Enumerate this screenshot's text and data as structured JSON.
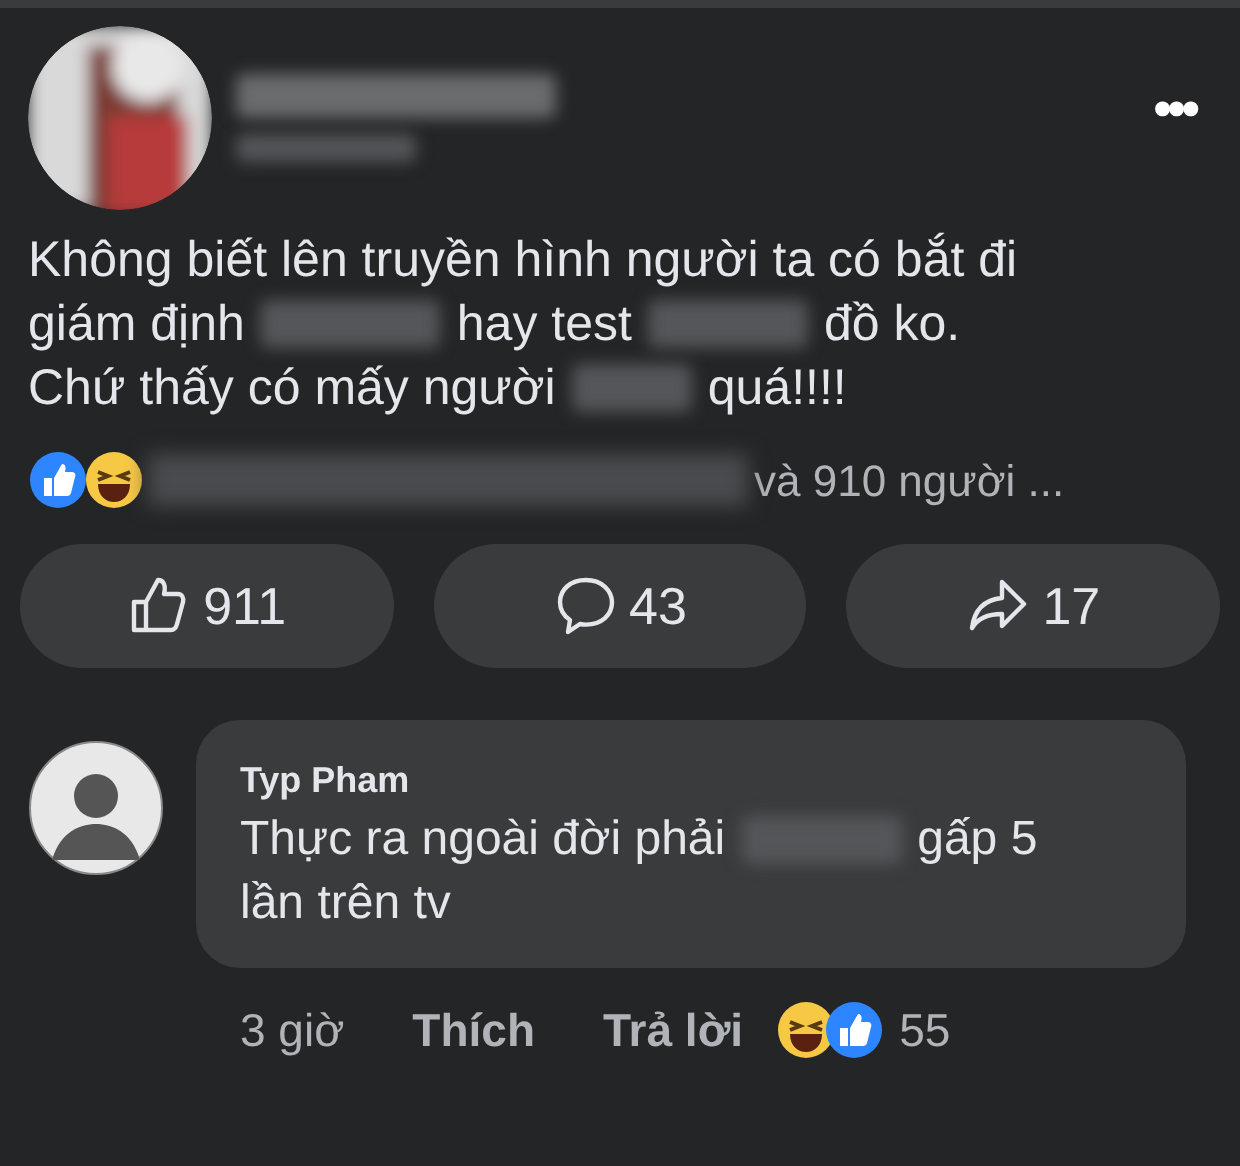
{
  "post": {
    "menu_icon": "•••",
    "body_lines": [
      [
        {
          "kind": "text",
          "text": "Không biết lên truyền hình người ta có bắt đi"
        }
      ],
      [
        {
          "kind": "text",
          "text": "giám định"
        },
        {
          "kind": "blur"
        },
        {
          "kind": "text",
          "text": "hay test"
        },
        {
          "kind": "blur"
        },
        {
          "kind": "text",
          "text": "đồ ko."
        }
      ],
      [
        {
          "kind": "text",
          "text": "Chứ thấy có mấy người"
        },
        {
          "kind": "blur"
        },
        {
          "kind": "text",
          "text": "quá!!!!"
        }
      ]
    ],
    "reactions_summary": "và 910 người ...",
    "actions": [
      {
        "kind": "like",
        "count": "911"
      },
      {
        "kind": "comment",
        "count": "43"
      },
      {
        "kind": "share",
        "count": "17"
      }
    ]
  },
  "comment": {
    "author": "Typ Pham",
    "lines": [
      [
        {
          "kind": "text",
          "text": "Thực ra ngoài đời phải"
        },
        {
          "kind": "blur"
        },
        {
          "kind": "text",
          "text": "gấp 5"
        }
      ],
      [
        {
          "kind": "text",
          "text": "lần trên tv"
        }
      ]
    ],
    "time": "3 giờ",
    "like_label": "Thích",
    "reply_label": "Trả lời",
    "reaction_count": "55"
  }
}
